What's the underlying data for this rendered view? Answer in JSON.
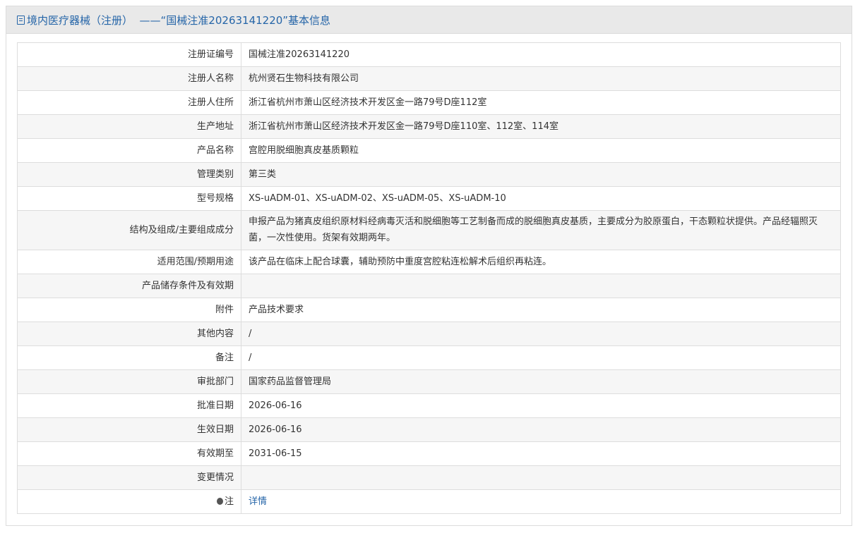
{
  "header": {
    "title": "境内医疗器械（注册）  ——“国械注准20263141220”基本信息",
    "icon": "document-icon"
  },
  "rows": [
    {
      "label": "注册证编号",
      "value": "国械注准20263141220"
    },
    {
      "label": "注册人名称",
      "value": "杭州贤石生物科技有限公司"
    },
    {
      "label": "注册人住所",
      "value": "浙江省杭州市萧山区经济技术开发区金一路79号D座112室"
    },
    {
      "label": "生产地址",
      "value": "浙江省杭州市萧山区经济技术开发区金一路79号D座110室、112室、114室"
    },
    {
      "label": "产品名称",
      "value": "宫腔用脱细胞真皮基质颗粒"
    },
    {
      "label": "管理类别",
      "value": "第三类"
    },
    {
      "label": "型号规格",
      "value": "XS-uADM-01、XS-uADM-02、XS-uADM-05、XS-uADM-10"
    },
    {
      "label": "结构及组成/主要组成成分",
      "value": "申报产品为猪真皮组织原材料经病毒灭活和脱细胞等工艺制备而成的脱细胞真皮基质，主要成分为胶原蛋白，干态颗粒状提供。产品经辐照灭菌，一次性使用。货架有效期两年。"
    },
    {
      "label": "适用范围/预期用途",
      "value": "该产品在临床上配合球囊，辅助预防中重度宫腔粘连松解术后组织再粘连。"
    },
    {
      "label": "产品储存条件及有效期",
      "value": ""
    },
    {
      "label": "附件",
      "value": "产品技术要求"
    },
    {
      "label": "其他内容",
      "value": "/"
    },
    {
      "label": "备注",
      "value": "/"
    },
    {
      "label": "审批部门",
      "value": "国家药品监督管理局"
    },
    {
      "label": "批准日期",
      "value": "2026-06-16"
    },
    {
      "label": "生效日期",
      "value": "2026-06-16"
    },
    {
      "label": "有效期至",
      "value": "2031-06-15"
    },
    {
      "label": "变更情况",
      "value": ""
    }
  ],
  "note_row": {
    "label": "注",
    "icon": "lightbulb-icon",
    "link_text": "详情"
  },
  "colors": {
    "accent": "#2565a8",
    "header_bg": "#e9e9e9",
    "stripe_bg": "#f6f6f6"
  }
}
